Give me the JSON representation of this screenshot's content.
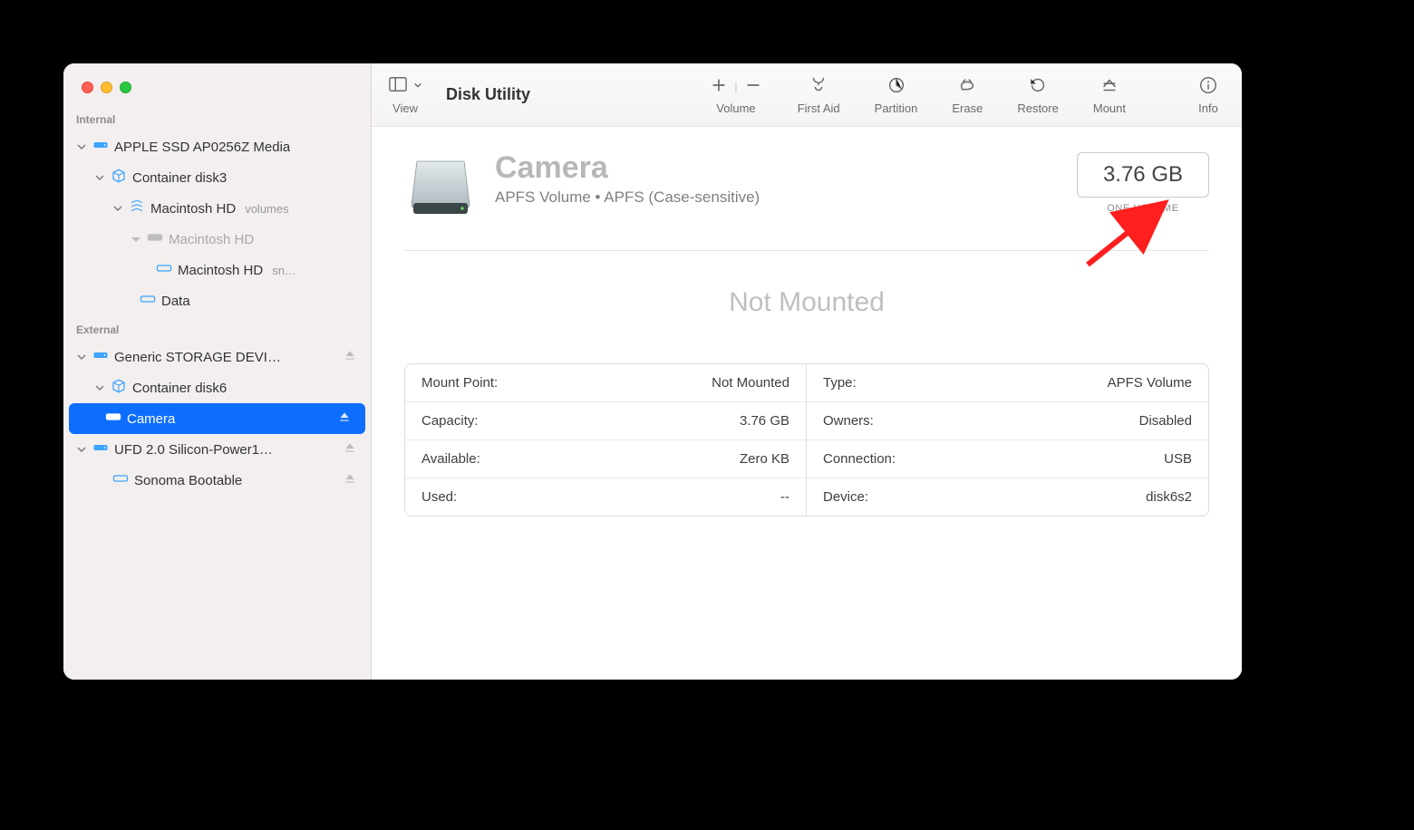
{
  "toolbar": {
    "app_title": "Disk Utility",
    "view_label": "View",
    "volume_label": "Volume",
    "firstaid_label": "First Aid",
    "partition_label": "Partition",
    "erase_label": "Erase",
    "restore_label": "Restore",
    "mount_label": "Mount",
    "info_label": "Info"
  },
  "sidebar": {
    "section_internal": "Internal",
    "section_external": "External",
    "internal_disk": {
      "label": "APPLE SSD AP0256Z Media",
      "container": {
        "label": "Container disk3",
        "group": {
          "label": "Macintosh HD",
          "suffix": "volumes"
        },
        "vol_dim": {
          "label": "Macintosh HD"
        },
        "vol_snap": {
          "label": "Macintosh HD",
          "suffix": "sn…"
        },
        "vol_data": {
          "label": "Data"
        }
      }
    },
    "external": {
      "disk1": {
        "label": "Generic STORAGE DEVI…"
      },
      "container": {
        "label": "Container disk6"
      },
      "camera": {
        "label": "Camera"
      },
      "disk2": {
        "label": "UFD 2.0 Silicon-Power1…"
      },
      "sonoma": {
        "label": "Sonoma Bootable"
      }
    }
  },
  "main": {
    "title": "Camera",
    "subtitle": "APFS Volume • APFS (Case-sensitive)",
    "size": "3.76 GB",
    "size_caption": "ONE VOLUME",
    "status": "Not Mounted",
    "props": {
      "mount_point_k": "Mount Point:",
      "mount_point_v": "Not Mounted",
      "capacity_k": "Capacity:",
      "capacity_v": "3.76 GB",
      "available_k": "Available:",
      "available_v": "Zero KB",
      "used_k": "Used:",
      "used_v": "--",
      "type_k": "Type:",
      "type_v": "APFS Volume",
      "owners_k": "Owners:",
      "owners_v": "Disabled",
      "connection_k": "Connection:",
      "connection_v": "USB",
      "device_k": "Device:",
      "device_v": "disk6s2"
    }
  }
}
